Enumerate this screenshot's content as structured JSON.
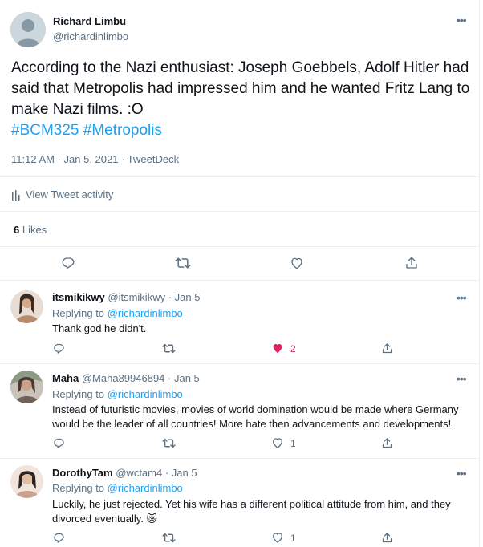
{
  "main_tweet": {
    "author_name": "Richard Limbu",
    "author_handle": "@richardinlimbo",
    "text": "According to the Nazi enthusiast: Joseph Goebbels, Adolf Hitler had said that Metropolis had impressed him and he wanted Fritz Lang to make Nazi films. :O",
    "hashtags": [
      "#BCM325",
      "#Metropolis"
    ],
    "meta": "11:12 AM · Jan 5, 2021 · TweetDeck",
    "activity_label": "View Tweet activity",
    "likes_count": "6",
    "likes_label": "Likes"
  },
  "replies": [
    {
      "name": "itsmikikwy",
      "handle": "@itsmikikwy",
      "time": "· Jan 5",
      "replying_prefix": "Replying to",
      "replying_to": "@richardinlimbo",
      "text": "Thank god he didn't.",
      "like_count": "2",
      "liked": true
    },
    {
      "name": "Maha",
      "handle": "@Maha89946894",
      "time": "· Jan 5",
      "replying_prefix": "Replying to",
      "replying_to": "@richardinlimbo",
      "text": "Instead of futuristic movies, movies of world domination would be made where Germany would be the leader of all countries! More hate then advancements and developments!",
      "like_count": "1",
      "liked": false
    },
    {
      "name": "DorothyTam",
      "handle": "@wctam4",
      "time": "· Jan 5",
      "replying_prefix": "Replying to",
      "replying_to": "@richardinlimbo",
      "text": "Luckily, he just rejected. Yet his wife has a different political attitude from him, and they divorced eventually. 😿",
      "like_count": "1",
      "liked": false
    }
  ],
  "colors": {
    "accent": "#1da1f2",
    "like_red": "#e0245e",
    "secondary_text": "#5b7083",
    "divider": "#ebeef0"
  },
  "icons": [
    "default-avatar-icon",
    "more-icon",
    "bar-chart-icon",
    "reply-icon",
    "retweet-icon",
    "like-icon",
    "share-icon"
  ]
}
